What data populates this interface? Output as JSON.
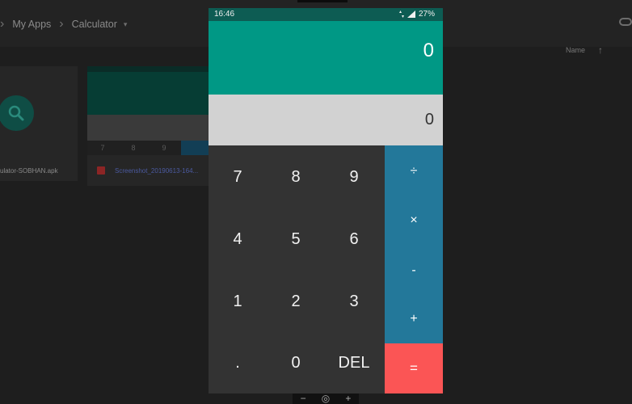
{
  "background": {
    "breadcrumb": {
      "items": [
        "My Apps",
        "Calculator"
      ],
      "separator": "›",
      "caret": "▾"
    },
    "sort": {
      "label": "Name",
      "arrow": "↑"
    },
    "files": [
      {
        "name": "ulator-SOBHAN.apk",
        "icon": "search-icon"
      },
      {
        "name": "Screenshot_20190613-164...",
        "icon": "image-icon",
        "thumb_keys": [
          "7",
          "8",
          "9"
        ]
      }
    ],
    "zoom_bar": {
      "minus": "−",
      "reset": "◎",
      "plus": "+"
    }
  },
  "status_bar": {
    "time": "16:46",
    "battery": "27%",
    "icons": [
      "data-arrows-icon",
      "signal-icon"
    ]
  },
  "calculator": {
    "display": "0",
    "result": "0",
    "keys": {
      "k7": "7",
      "k8": "8",
      "k9": "9",
      "k4": "4",
      "k5": "5",
      "k6": "6",
      "k1": "1",
      "k2": "2",
      "k3": "3",
      "dot": ".",
      "k0": "0",
      "del": "DEL"
    },
    "operators": {
      "divide": "÷",
      "multiply": "×",
      "minus": "-",
      "plus": "+",
      "equals": "="
    },
    "colors": {
      "display_bg": "#009885",
      "status_bg": "#0d5c53",
      "result_bg": "#d2d2d2",
      "keypad_bg": "#333333",
      "operators_bg": "#23789a",
      "equals_bg": "#fb5555"
    }
  }
}
